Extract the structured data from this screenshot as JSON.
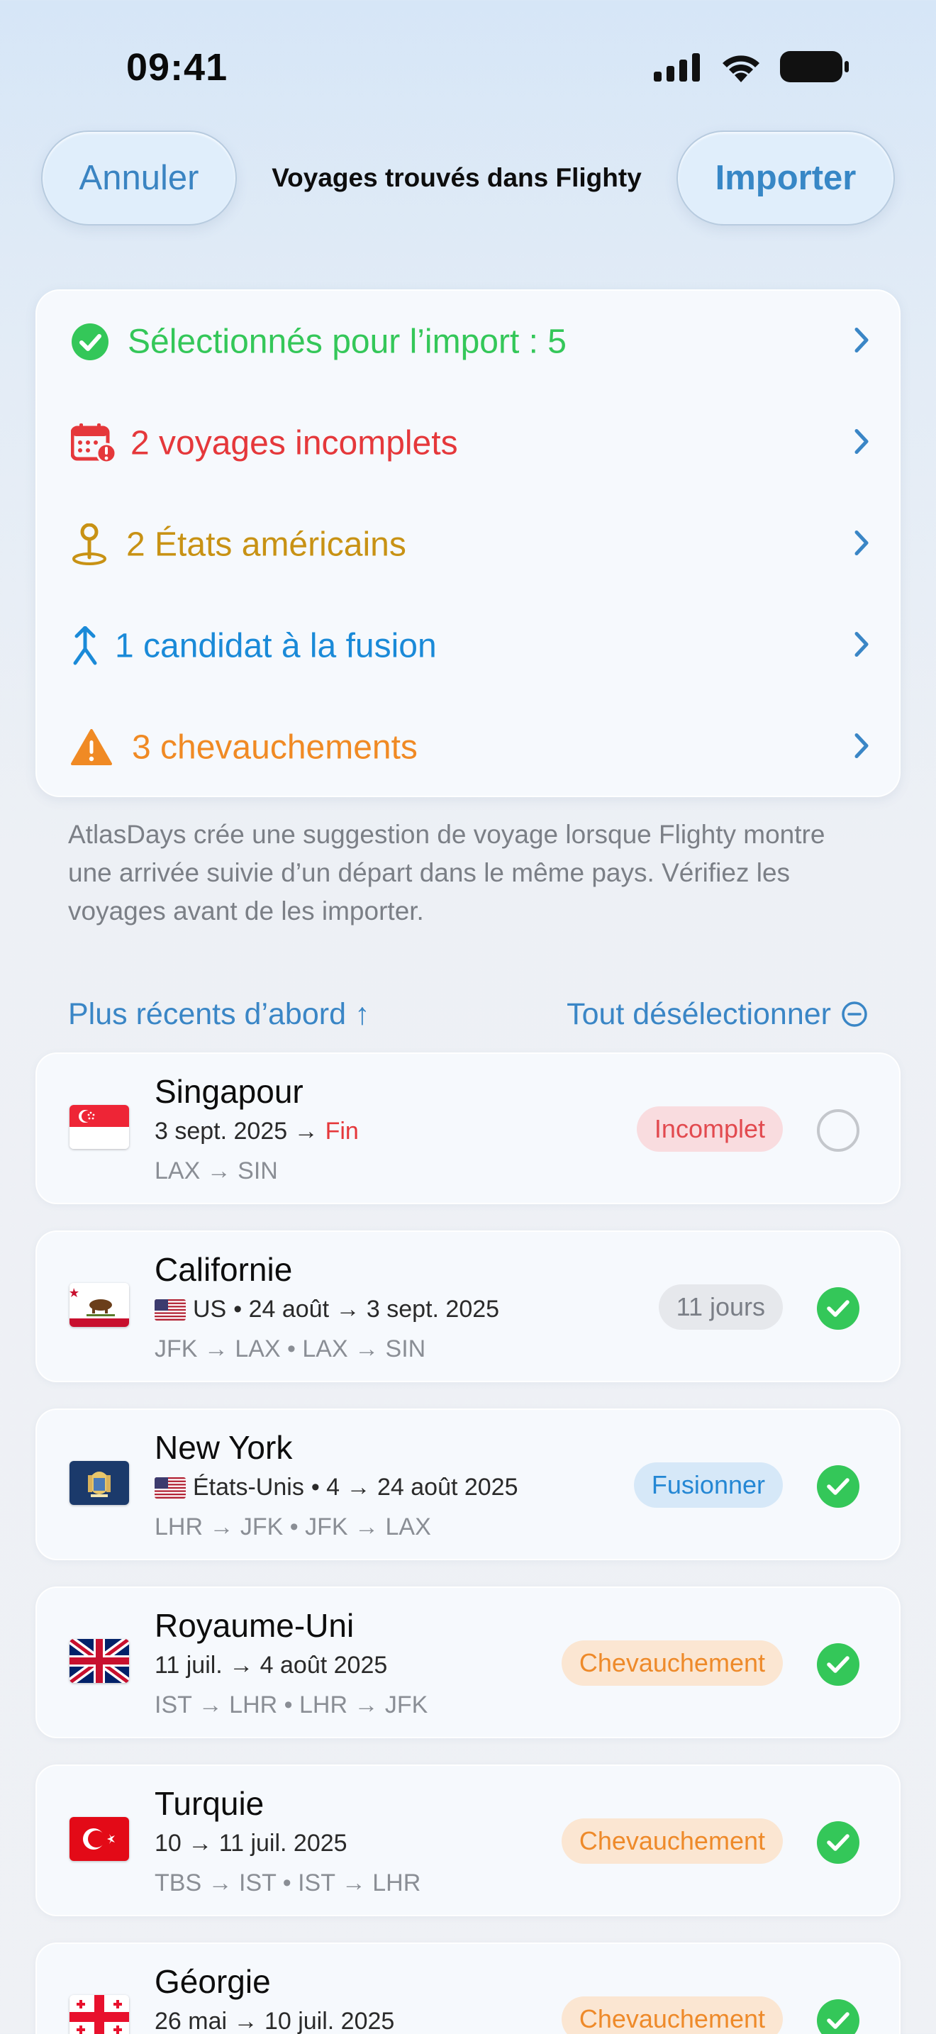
{
  "status_bar": {
    "time": "09:41"
  },
  "header": {
    "cancel_label": "Annuler",
    "title": "Voyages trouvés dans Flighty",
    "import_label": "Importer"
  },
  "summary": {
    "selected": "Sélectionnés pour l’import : 5",
    "incomplete": "2 voyages incomplets",
    "us_states": "2 États américains",
    "merge": "1 candidat à la fusion",
    "overlaps": "3 chevauchements"
  },
  "note": "AtlasDays crée une suggestion de voyage lorsque Flighty montre une arrivée suivie d’un départ dans le même pays. Vérifiez les voyages avant de les importer.",
  "sort": {
    "order_label": "Plus récents d’abord ↑",
    "deselect_label": "Tout désélectionner"
  },
  "trips": [
    {
      "name": "Singapour",
      "dates": "3 sept. 2025 →",
      "dates_end": "Fin",
      "route": "LAX → SIN",
      "badge": "Incomplet",
      "flag_icon": "singapore-flag-icon",
      "selected": false
    },
    {
      "name": "Californie",
      "country": "US",
      "dates": "• 24 août → 3 sept. 2025",
      "route": "JFK → LAX • LAX → SIN",
      "badge": "11 jours",
      "flag_icon": "california-flag-icon",
      "selected": true
    },
    {
      "name": "New York",
      "country": "États-Unis",
      "dates": "• 4 → 24 août 2025",
      "route": "LHR → JFK • JFK → LAX",
      "badge": "Fusionner",
      "flag_icon": "new-york-flag-icon",
      "selected": true
    },
    {
      "name": "Royaume-Uni",
      "dates": "11 juil. → 4 août 2025",
      "route": "IST → LHR • LHR → JFK",
      "badge": "Chevauchement",
      "flag_icon": "uk-flag-icon",
      "selected": true
    },
    {
      "name": "Turquie",
      "dates": "10 → 11 juil. 2025",
      "route": "TBS → IST • IST → LHR",
      "badge": "Chevauchement",
      "flag_icon": "turkey-flag-icon",
      "selected": true
    },
    {
      "name": "Géorgie",
      "dates": "26 mai → 10 juil. 2025",
      "route": "",
      "badge": "Chevauchement",
      "flag_icon": "georgia-flag-icon",
      "selected": true
    }
  ],
  "colors": {
    "accent_blue": "#3a86c6",
    "green": "#34c759",
    "red": "#e5383b",
    "yellow": "#c89214",
    "blue": "#1a8ad8",
    "orange": "#f08a24"
  }
}
